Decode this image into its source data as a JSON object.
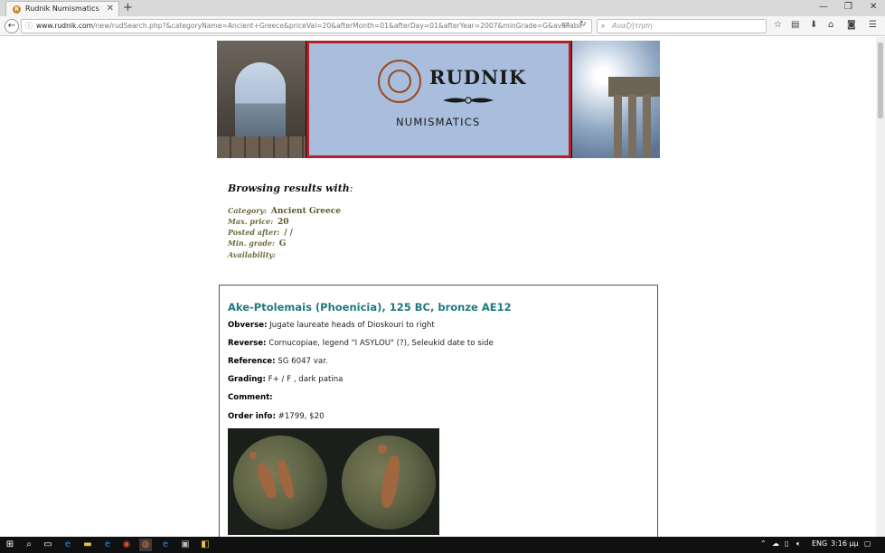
{
  "browser": {
    "tab_title": "Rudnik Numismatics",
    "tab_favicon_letter": "R",
    "url_host": "www.rudnik.com",
    "url_path": "/new/rudSearch.php?&categoryName=Ancient+Greece&priceVal=20&afterMonth=01&afterDay=01&afterYear=2007&minGrade=G&availabil",
    "search_placeholder": "Αναζήτηση",
    "icons": [
      "info-icon",
      "reader-view-icon",
      "reload-icon",
      "search-icon",
      "bookmark-star-icon",
      "library-icon",
      "download-icon",
      "home-icon",
      "pocket-icon",
      "menu-icon",
      "new-tab-icon",
      "close-tab-icon",
      "minimize-icon",
      "restore-icon",
      "close-window-icon"
    ]
  },
  "banner": {
    "brand": "RUDNIK",
    "sub": "NUMISMATICS",
    "colors": {
      "frame": "#b3202a",
      "sky": "#a9bddd",
      "coin": "#9b4a23"
    }
  },
  "criteria": {
    "heading": "Browsing results with",
    "heading_colon": ":",
    "category_label": "Category",
    "category_value": "Ancient Greece",
    "price_label": "Max. price",
    "price_value": "20",
    "posted_label": "Posted after",
    "posted_value": "/ /",
    "grade_label": "Min. grade",
    "grade_value": "G",
    "availability_label": "Availability",
    "availability_value": ""
  },
  "result": {
    "title": "Ake-Ptolemais (Phoenicia), 125 BC, bronze AE12",
    "obverse_label": "Obverse:",
    "obverse_value": "Jugate laureate heads of Dioskouri to right",
    "reverse_label": "Reverse:",
    "reverse_value": "Cornucopiae, legend \"I ASYLOU\" (?), Seleukid date to side",
    "reference_label": "Reference:",
    "reference_value": "SG 6047 var.",
    "grading_label": "Grading:",
    "grading_value": "F+ / F , dark patina",
    "comment_label": "Comment:",
    "comment_value": "",
    "order_label": "Order info:",
    "order_value": "#1799, $20",
    "title_color": "#1f7a80"
  },
  "taskbar": {
    "lang": "ENG",
    "time": "3:16 μμ",
    "icons": [
      "windows-start-icon",
      "search-icon",
      "task-view-icon",
      "edge-icon",
      "file-explorer-icon",
      "ie-icon",
      "chrome-icon",
      "firefox-icon",
      "edge-alt-icon",
      "app-icon",
      "app-icon-2"
    ]
  }
}
